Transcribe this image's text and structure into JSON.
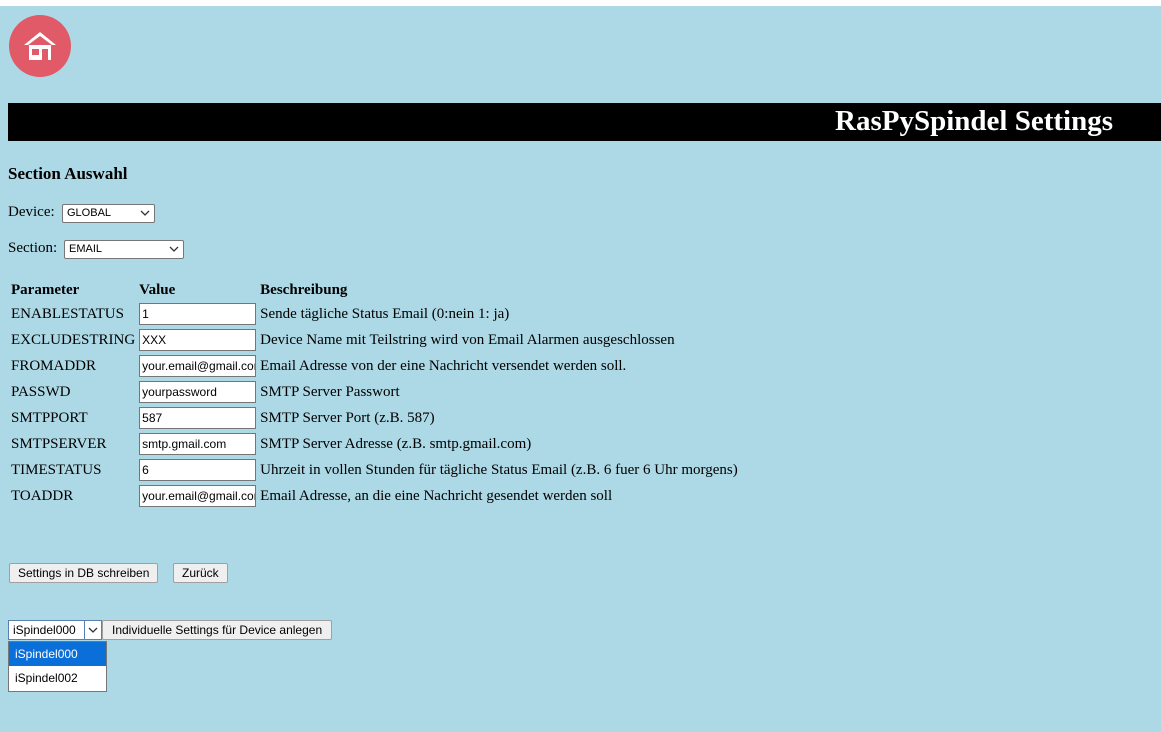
{
  "header": {
    "title": "RasPySpindel Settings",
    "home_icon": "home-icon",
    "home_color": "#e05a68"
  },
  "section_select": {
    "heading": "Section Auswahl",
    "device_label": "Device:",
    "device_value": "GLOBAL",
    "section_label": "Section:",
    "section_value": "EMAIL"
  },
  "table": {
    "headers": [
      "Parameter",
      "Value",
      "Beschreibung"
    ],
    "rows": [
      {
        "param": "ENABLESTATUS",
        "value": "1",
        "desc": "Sende tägliche Status Email (0:nein 1: ja)"
      },
      {
        "param": "EXCLUDESTRING",
        "value": "XXX",
        "desc": "Device Name mit Teilstring wird von Email Alarmen ausgeschlossen"
      },
      {
        "param": "FROMADDR",
        "value": "your.email@gmail.com",
        "desc": "Email Adresse von der eine Nachricht versendet werden soll."
      },
      {
        "param": "PASSWD",
        "value": "yourpassword",
        "desc": "SMTP Server Passwort"
      },
      {
        "param": "SMTPPORT",
        "value": "587",
        "desc": "SMTP Server Port (z.B. 587)"
      },
      {
        "param": "SMTPSERVER",
        "value": "smtp.gmail.com",
        "desc": "SMTP Server Adresse (z.B. smtp.gmail.com)"
      },
      {
        "param": "TIMESTATUS",
        "value": "6",
        "desc": "Uhrzeit in vollen Stunden für tägliche Status Email (z.B. 6 fuer 6 Uhr morgens)"
      },
      {
        "param": "TOADDR",
        "value": "your.email@gmail.com",
        "desc": "Email Adresse, an die eine Nachricht gesendet werden soll"
      }
    ]
  },
  "actions": {
    "save_label": "Settings in DB schreiben",
    "back_label": "Zurück"
  },
  "device_create": {
    "selected": "iSpindel000",
    "options": [
      "iSpindel000",
      "iSpindel002"
    ],
    "button_label": "Individuelle Settings für Device anlegen"
  },
  "colors": {
    "background": "#add8e6",
    "titlebar": "#000000",
    "selected_option": "#0a6fd8"
  }
}
